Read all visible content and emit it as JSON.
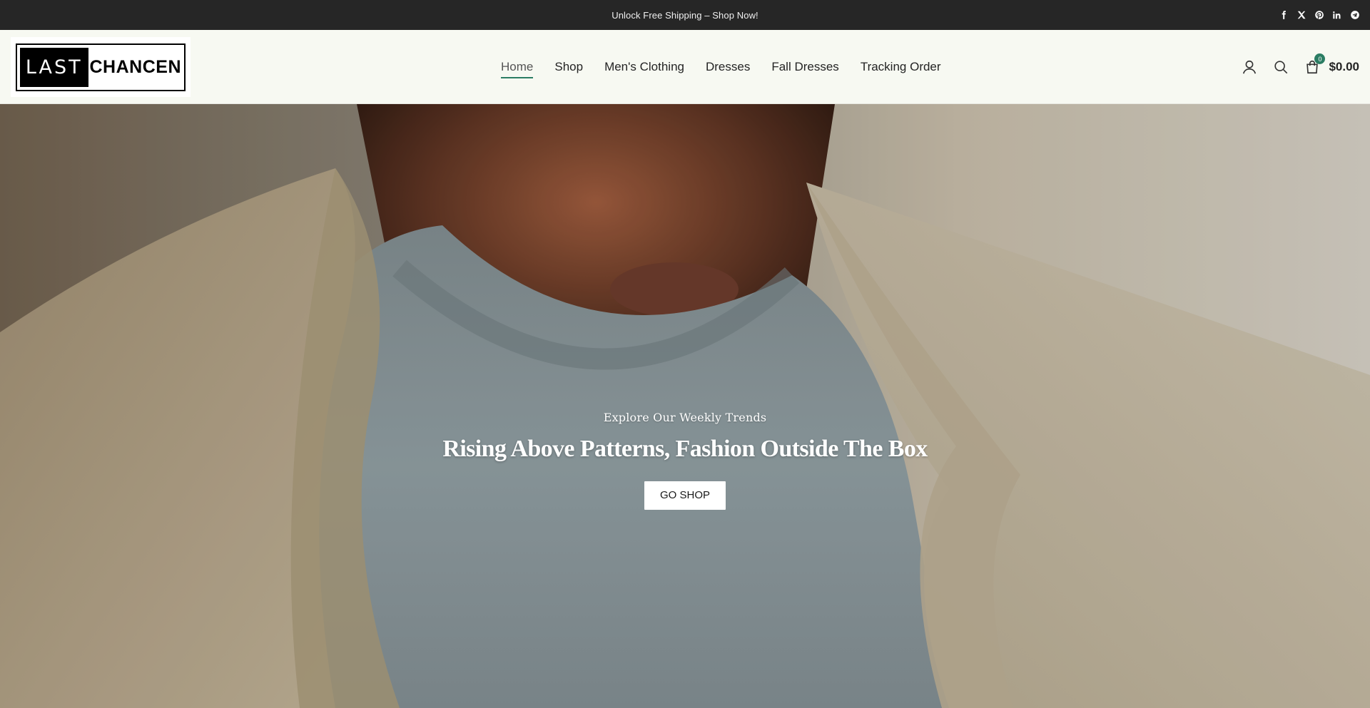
{
  "topbar": {
    "message": "Unlock Free Shipping – Shop Now!",
    "social": [
      "facebook-icon",
      "x-icon",
      "pinterest-icon",
      "linkedin-icon",
      "telegram-icon"
    ]
  },
  "header": {
    "logo": {
      "part1": "LAST",
      "part2": "CHANCEN"
    },
    "nav": [
      {
        "label": "Home",
        "active": true
      },
      {
        "label": "Shop"
      },
      {
        "label": "Men's Clothing"
      },
      {
        "label": "Dresses"
      },
      {
        "label": "Fall Dresses"
      },
      {
        "label": "Tracking Order"
      }
    ],
    "cart": {
      "count": "0",
      "total": "$0.00"
    }
  },
  "hero": {
    "subtitle": "Explore Our Weekly Trends",
    "title": "Rising Above Patterns, Fashion Outside The Box",
    "button": "GO SHOP"
  },
  "colors": {
    "topbar": "#262626",
    "accent": "#2b7d63",
    "header_bg": "#f7f9f2"
  }
}
